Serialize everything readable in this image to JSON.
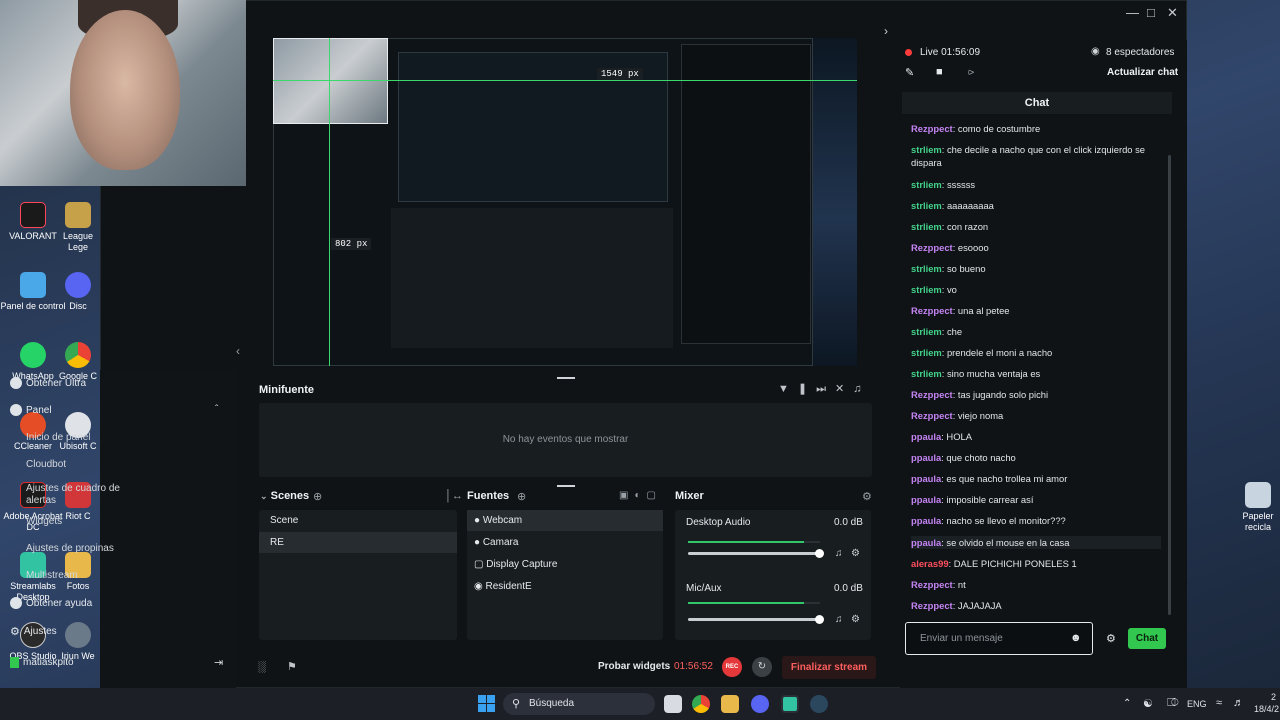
{
  "desktop": {
    "icons": [
      {
        "label": "VALORANT"
      },
      {
        "label": "League Lege"
      },
      {
        "label": "Panel de control"
      },
      {
        "label": "Disc"
      },
      {
        "label": "WhatsApp"
      },
      {
        "label": "Google C"
      },
      {
        "label": "CCleaner"
      },
      {
        "label": "Ubisoft C"
      },
      {
        "label": "Adobe Acrobat DC"
      },
      {
        "label": "Riot C"
      },
      {
        "label": "Streamlabs Desktop"
      },
      {
        "label": "Fotos"
      },
      {
        "label": "OBS Studio"
      },
      {
        "label": "Iriun We"
      },
      {
        "label": "Papeler recicla"
      }
    ]
  },
  "sidebar": {
    "obtener_ultra": "Obtener Ultra",
    "panel": "Panel",
    "sub_items": [
      "Inicio de panel",
      "Cloudbot",
      "Ajustes de cuadro de alertas",
      "Widgets",
      "Ajustes de propinas",
      "Multistream"
    ],
    "obtener_ayuda": "Obtener ayuda",
    "ajustes": "Ajustes",
    "user": "matiaskpito"
  },
  "preview": {
    "dim1": "1549 px",
    "dim2": "802 px"
  },
  "minifuente": {
    "title": "Minifuente",
    "empty": "No hay eventos que mostrar"
  },
  "scenes": {
    "title": "Scenes",
    "items": [
      "Scene",
      "RE"
    ]
  },
  "sources": {
    "title": "Fuentes",
    "items": [
      "Webcam",
      "Camara",
      "Display Capture",
      "ResidentE"
    ]
  },
  "mixer": {
    "title": "Mixer",
    "channels": [
      {
        "name": "Desktop Audio",
        "level": "0.0 dB",
        "fill": 0.88
      },
      {
        "name": "Mic/Aux",
        "level": "0.0 dB",
        "fill": 0.88
      }
    ]
  },
  "bottom_bar": {
    "probar": "Probar widgets",
    "time": "01:56:52",
    "rec": "REC",
    "finalizar": "Finalizar stream"
  },
  "chat_panel": {
    "live": "Live 01:56:09",
    "viewers": "8 espectadores",
    "actualizar": "Actualizar chat",
    "header": "Chat",
    "messages": [
      {
        "user": "Rezppect",
        "text": ": como de costumbre",
        "color": "#c584f5"
      },
      {
        "user": "strliem",
        "text": ": che decile a nacho que con el click izquierdo se dispara",
        "color": "#43d28a"
      },
      {
        "user": "strliem",
        "text": ": ssssss",
        "color": "#43d28a"
      },
      {
        "user": "strliem",
        "text": ": aaaaaaaaa",
        "color": "#43d28a"
      },
      {
        "user": "strliem",
        "text": ": con razon",
        "color": "#43d28a"
      },
      {
        "user": "Rezppect",
        "text": ": esoooo",
        "color": "#c584f5"
      },
      {
        "user": "strliem",
        "text": ": so bueno",
        "color": "#43d28a"
      },
      {
        "user": "strliem",
        "text": ": vo",
        "color": "#43d28a"
      },
      {
        "user": "Rezppect",
        "text": ": una al petee",
        "color": "#c584f5"
      },
      {
        "user": "strliem",
        "text": ": che",
        "color": "#43d28a"
      },
      {
        "user": "strliem",
        "text": ": prendele el moni a nacho",
        "color": "#43d28a"
      },
      {
        "user": "strliem",
        "text": ": sino mucha ventaja es",
        "color": "#43d28a"
      },
      {
        "user": "Rezppect",
        "text": ": tas jugando solo pichi",
        "color": "#c584f5"
      },
      {
        "user": "Rezppect",
        "text": ": viejo noma",
        "color": "#c584f5"
      },
      {
        "user": "ppaula",
        "text": ": HOLA",
        "color": "#c584f5"
      },
      {
        "user": "ppaula",
        "text": ": que choto nacho",
        "color": "#c584f5"
      },
      {
        "user": "ppaula",
        "text": ": es que nacho trollea mi amor",
        "color": "#c584f5"
      },
      {
        "user": "ppaula",
        "text": ": imposible carrear así",
        "color": "#c584f5"
      },
      {
        "user": "ppaula",
        "text": ": nacho se llevo el monitor???",
        "color": "#c584f5"
      },
      {
        "user": "ppaula",
        "text": ": se olvido el mouse en la casa",
        "color": "#c584f5"
      },
      {
        "user": "aleras99",
        "text": ": DALE PICHICHI PONELES 1",
        "color": "#ff4f5e"
      },
      {
        "user": "Rezppect",
        "text": ": nt",
        "color": "#c584f5"
      },
      {
        "user": "Rezppect",
        "text": ": JAJAJAJA",
        "color": "#c584f5"
      }
    ],
    "input_placeholder": "Enviar un mensaje",
    "send": "Chat"
  },
  "taskbar": {
    "search": "Búsqueda",
    "lang": "ENG",
    "clock_partial": "2",
    "date_partial": "18/4/2"
  }
}
